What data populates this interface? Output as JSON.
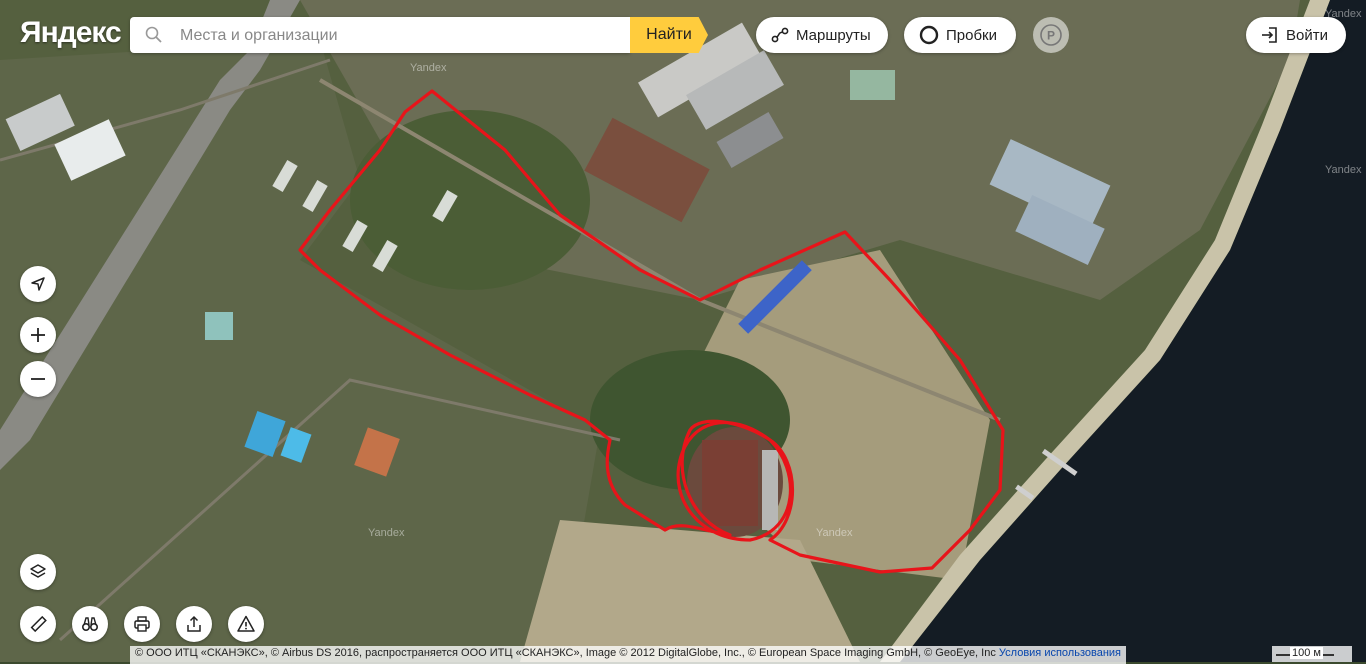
{
  "header": {
    "logo_text": "Яндекс",
    "search_placeholder": "Места и организации",
    "find_label": "Найти",
    "routes_label": "Маршруты",
    "traffic_label": "Пробки",
    "login_label": "Войти"
  },
  "map": {
    "watermark": "Yandex",
    "route_color": "#e8141a",
    "river_color": "#141c24"
  },
  "footer": {
    "attribution": "© ООО ИТЦ «СКАНЭКС», © Airbus DS 2016, распространяется ООО ИТЦ «СКАНЭКС», Image © 2012 DigitalGlobe, Inc., © European Space Imaging GmbH, © GeoEye, Inc",
    "terms_label": "Условия использования",
    "scale_label": "100 м"
  }
}
